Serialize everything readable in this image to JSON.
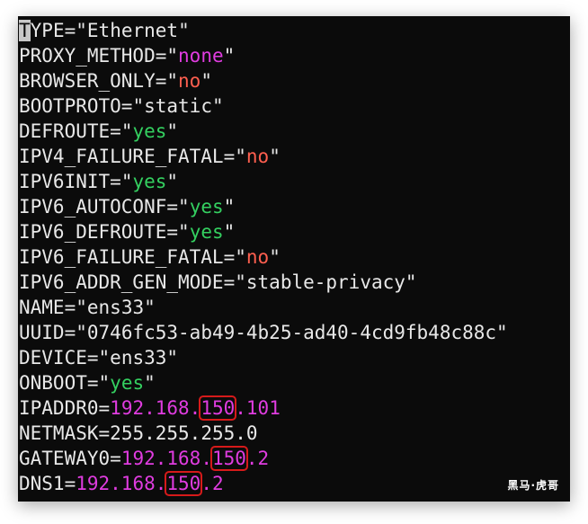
{
  "lines": [
    {
      "key": "TYPE",
      "value": "Ethernet",
      "quoted": true,
      "valueColor": "str"
    },
    {
      "key": "PROXY_METHOD",
      "value": "none",
      "quoted": true,
      "valueColor": "v-none"
    },
    {
      "key": "BROWSER_ONLY",
      "value": "no",
      "quoted": true,
      "valueColor": "v-no"
    },
    {
      "key": "BOOTPROTO",
      "value": "static",
      "quoted": true,
      "valueColor": "str"
    },
    {
      "key": "DEFROUTE",
      "value": "yes",
      "quoted": true,
      "valueColor": "v-yes"
    },
    {
      "key": "IPV4_FAILURE_FATAL",
      "value": "no",
      "quoted": true,
      "valueColor": "v-no"
    },
    {
      "key": "IPV6INIT",
      "value": "yes",
      "quoted": true,
      "valueColor": "v-yes"
    },
    {
      "key": "IPV6_AUTOCONF",
      "value": "yes",
      "quoted": true,
      "valueColor": "v-yes"
    },
    {
      "key": "IPV6_DEFROUTE",
      "value": "yes",
      "quoted": true,
      "valueColor": "v-yes"
    },
    {
      "key": "IPV6_FAILURE_FATAL",
      "value": "no",
      "quoted": true,
      "valueColor": "v-no"
    },
    {
      "key": "IPV6_ADDR_GEN_MODE",
      "value": "stable-privacy",
      "quoted": true,
      "valueColor": "str"
    },
    {
      "key": "NAME",
      "value": "ens33",
      "quoted": true,
      "valueColor": "str"
    },
    {
      "key": "UUID",
      "value": "0746fc53-ab49-4b25-ad40-4cd9fb48c88c",
      "quoted": true,
      "valueColor": "str"
    },
    {
      "key": "DEVICE",
      "value": "ens33",
      "quoted": true,
      "valueColor": "str"
    },
    {
      "key": "ONBOOT",
      "value": "yes",
      "quoted": true,
      "valueColor": "v-yes"
    },
    {
      "key": "IPADDR0",
      "ip": [
        "192.168.",
        "150",
        ".101"
      ],
      "ipColor": "ip",
      "highlight": true
    },
    {
      "key": "NETMASK",
      "value": "255.255.255.0",
      "quoted": false,
      "valueColor": "plain"
    },
    {
      "key": "GATEWAY0",
      "ip": [
        "192.168.",
        "150",
        ".2"
      ],
      "ipColor": "ip",
      "highlight": true
    },
    {
      "key": "DNS1",
      "ip": [
        "192.168.",
        "150",
        ".2"
      ],
      "ipColor": "ip",
      "highlight": true
    }
  ],
  "cursor_char": "T",
  "watermark": "黑马·虎哥",
  "colors": {
    "background": "#0b0b0b",
    "text": "#e8e8e8",
    "magenta": "#e03ce0",
    "red": "#ff5f4f",
    "green": "#34d060",
    "highlight_box": "#d61a1a"
  }
}
